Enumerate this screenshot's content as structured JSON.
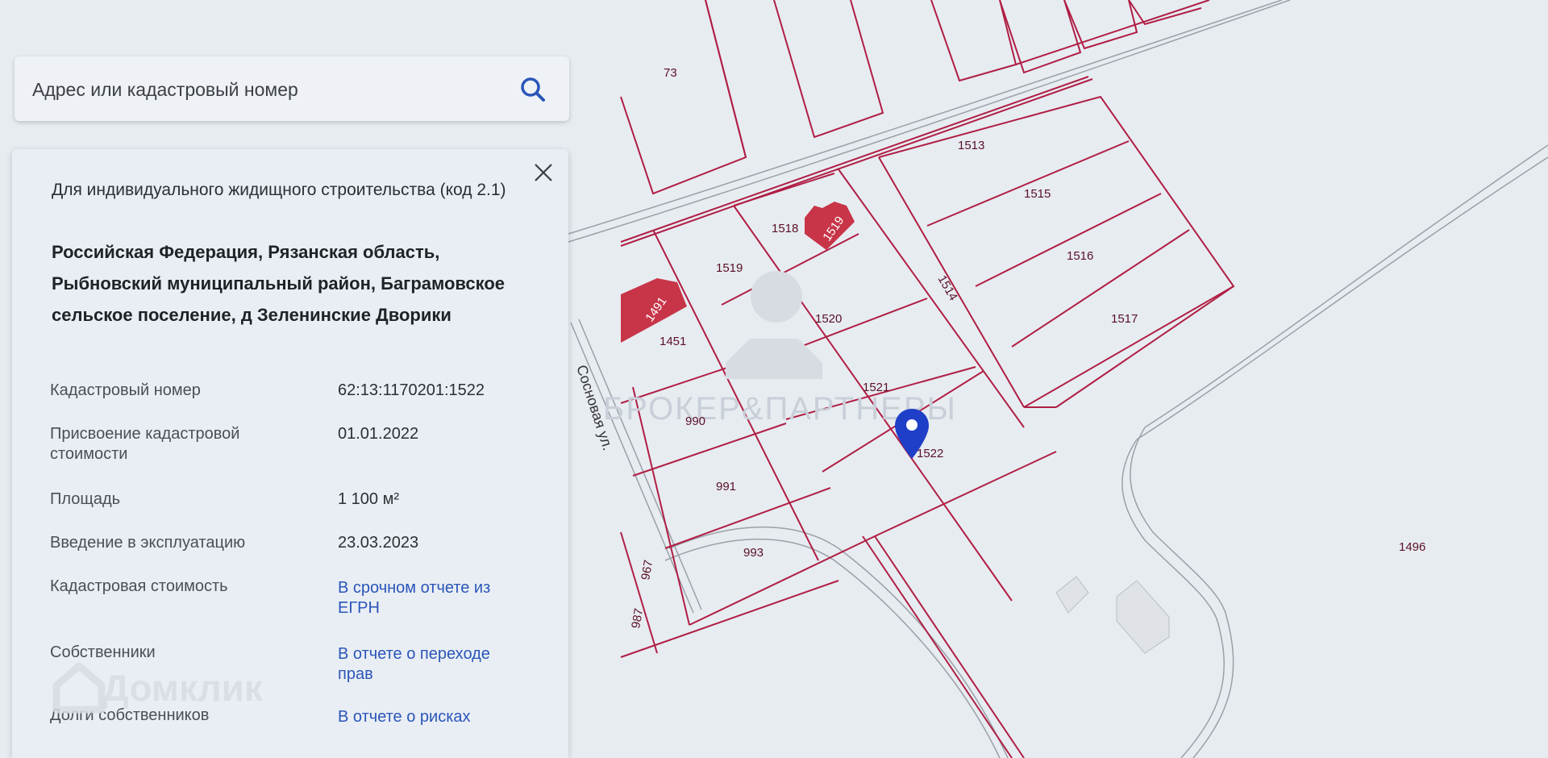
{
  "search": {
    "placeholder": "Адрес или кадастровый номер"
  },
  "panel": {
    "purpose": "Для индивидуального жидищного строительства (код 2.1)",
    "address": "Российская Федерация, Рязанская область, Рыбновский муниципальный район, Баграмовское сельское поселение, д Зеленинские Дворики",
    "rows": [
      {
        "label": "Кадастровый номер",
        "value": "62:13:1170201:1522"
      },
      {
        "label": "Присвоение кадастровой стоимости",
        "value": "01.01.2022"
      },
      {
        "label": "Площадь",
        "value": "1 100 м²"
      },
      {
        "label": "Введение в эксплуатацию",
        "value": "23.03.2023"
      },
      {
        "label": "Кадастровая стоимость",
        "link": "В срочном отчете из ЕГРН"
      },
      {
        "label": "Собственники",
        "link": "В отчете о переходе прав"
      },
      {
        "label": "Долги собственников",
        "link": "В отчете о рисках"
      }
    ]
  },
  "brand": {
    "name": "Домклик",
    "watermark": "БРОКЕР&ПАРТНЕРЫ"
  },
  "map": {
    "street": "Сосновая ул.",
    "plots": [
      "73",
      "1513",
      "1515",
      "1516",
      "1517",
      "1518",
      "1519",
      "1520",
      "1521",
      "1522",
      "1514",
      "1451",
      "1491",
      "1519",
      "990",
      "991",
      "993",
      "967",
      "987",
      "1496"
    ]
  },
  "colors": {
    "boundary": "#b01e44",
    "building": "#c83548",
    "link": "#2a55b8",
    "pin": "#1f3fc8"
  },
  "icons": {
    "search": "search-icon",
    "close": "close-icon",
    "pin": "location-pin-icon"
  }
}
